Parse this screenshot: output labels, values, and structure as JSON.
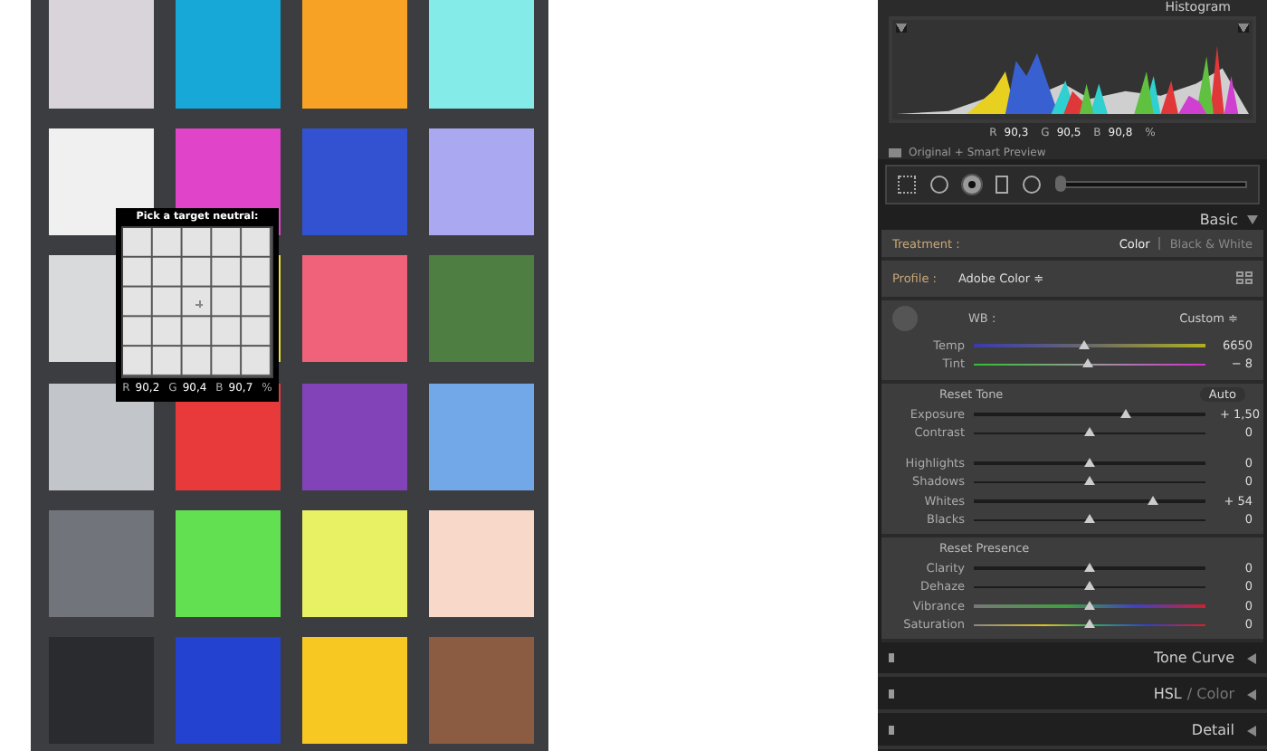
{
  "color_chart": {
    "rows": [
      {
        "patches": [
          {
            "color": "#d9d4da"
          },
          {
            "color": "#17a8d8"
          },
          {
            "color": "#f7a224"
          },
          {
            "color": "#84ebe8"
          }
        ]
      },
      {
        "patches": [
          {
            "color": "#f0f0f0"
          },
          {
            "color": "#e044c8"
          },
          {
            "color": "#3352d2"
          },
          {
            "color": "#a9a8f0"
          }
        ]
      },
      {
        "patches": [
          {
            "color": "#d8dadc"
          },
          {
            "color": "#f0e034"
          },
          {
            "color": "#f0627a"
          },
          {
            "color": "#4f7e42"
          }
        ]
      },
      {
        "patches": [
          {
            "color": "#c2c6ca"
          },
          {
            "color": "#e83a3a"
          },
          {
            "color": "#8242b8"
          },
          {
            "color": "#72a8e8"
          }
        ]
      },
      {
        "patches": [
          {
            "color": "#71757b"
          },
          {
            "color": "#62e052"
          },
          {
            "color": "#e8f064"
          },
          {
            "color": "#f8d8c8"
          }
        ]
      },
      {
        "patches": [
          {
            "color": "#2a2b2f"
          },
          {
            "color": "#2342d0"
          },
          {
            "color": "#f8c822"
          },
          {
            "color": "#8b5b42"
          }
        ]
      }
    ]
  },
  "loupe": {
    "title": "Pick a target neutral:",
    "readout": [
      {
        "label": "R",
        "value": "90,2"
      },
      {
        "label": "G",
        "value": "90,4"
      },
      {
        "label": "B",
        "value": "90,7"
      }
    ],
    "unit": "%"
  },
  "histogram": {
    "title": "Histogram",
    "readout": [
      {
        "label": "R",
        "value": "90,3"
      },
      {
        "label": "G",
        "value": "90,5"
      },
      {
        "label": "B",
        "value": "90,8"
      }
    ],
    "unit": "%",
    "preview_label": "Original + Smart Preview"
  },
  "toolbar": {
    "tools": [
      {
        "kind": "grid",
        "selected": false
      },
      {
        "kind": "spot",
        "selected": false
      },
      {
        "kind": "target",
        "selected": true
      },
      {
        "kind": "rect",
        "selected": false
      },
      {
        "kind": "circle",
        "selected": false
      }
    ],
    "slider": {
      "level": 0.02
    }
  },
  "basic": {
    "title": "Basic",
    "treatment": {
      "label": "Treatment :",
      "options": [
        {
          "label": "Color",
          "selected": true
        },
        {
          "label": "Black & White",
          "selected": false
        }
      ]
    },
    "profile": {
      "label": "Profile :",
      "value": "Adobe Color ≑"
    },
    "wb": {
      "label": "WB :",
      "value": "Custom ≑"
    },
    "wb_sliders": [
      {
        "label": "Temp",
        "kind": "temp",
        "level": 0.48,
        "value": "6650"
      },
      {
        "label": "Tint",
        "kind": "tint",
        "level": 0.49,
        "value": "− 8"
      }
    ],
    "tone": {
      "reset_label": "Reset Tone",
      "auto_label": "Auto",
      "sliders": [
        {
          "label": "Exposure",
          "kind": "plain",
          "level": 0.66,
          "value": "+ 1,50"
        },
        {
          "label": "Contrast",
          "kind": "plain",
          "level": 0.5,
          "value": "0"
        },
        {
          "label": "Highlights",
          "kind": "plain",
          "level": 0.5,
          "value": "0"
        },
        {
          "label": "Shadows",
          "kind": "plain",
          "level": 0.5,
          "value": "0"
        },
        {
          "label": "Whites",
          "kind": "plain",
          "level": 0.77,
          "value": "+ 54"
        },
        {
          "label": "Blacks",
          "kind": "plain",
          "level": 0.5,
          "value": "0"
        }
      ]
    },
    "presence": {
      "reset_label": "Reset Presence",
      "sliders": [
        {
          "label": "Clarity",
          "kind": "plain",
          "level": 0.5,
          "value": "0"
        },
        {
          "label": "Dehaze",
          "kind": "plain",
          "level": 0.5,
          "value": "0"
        },
        {
          "label": "Vibrance",
          "kind": "vibrance",
          "level": 0.5,
          "value": "0"
        },
        {
          "label": "Saturation",
          "kind": "saturation",
          "level": 0.5,
          "value": "0"
        }
      ]
    }
  },
  "panels": [
    {
      "title": "Tone Curve"
    },
    {
      "title": "HSL",
      "suffix": "/ Color"
    },
    {
      "title": "Detail"
    }
  ]
}
